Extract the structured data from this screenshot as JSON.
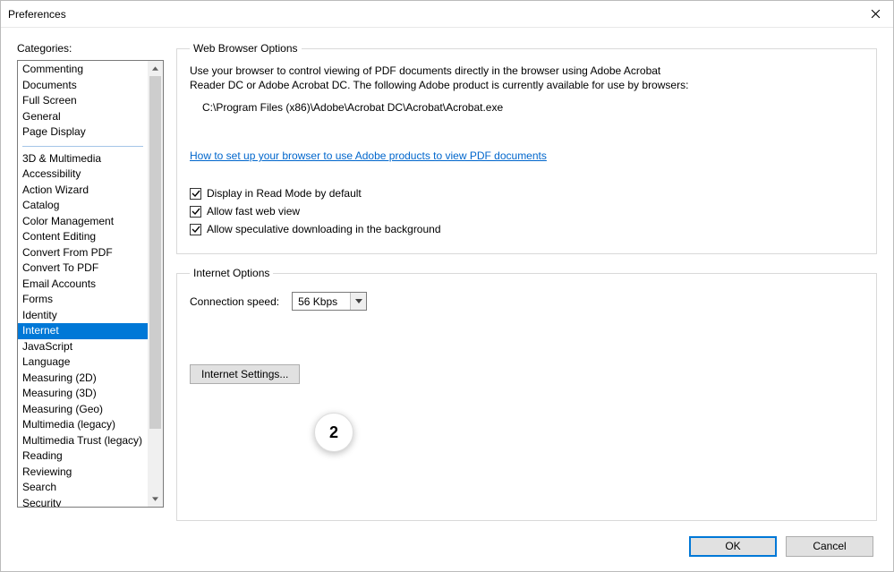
{
  "window": {
    "title": "Preferences"
  },
  "categories_label": "Categories:",
  "categories_group1": [
    "Commenting",
    "Documents",
    "Full Screen",
    "General",
    "Page Display"
  ],
  "categories_group2": [
    "3D & Multimedia",
    "Accessibility",
    "Action Wizard",
    "Catalog",
    "Color Management",
    "Content Editing",
    "Convert From PDF",
    "Convert To PDF",
    "Email Accounts",
    "Forms",
    "Identity",
    "Internet",
    "JavaScript",
    "Language",
    "Measuring (2D)",
    "Measuring (3D)",
    "Measuring (Geo)",
    "Multimedia (legacy)",
    "Multimedia Trust (legacy)",
    "Reading",
    "Reviewing",
    "Search",
    "Security"
  ],
  "selected_category": "Internet",
  "web_browser": {
    "legend": "Web Browser Options",
    "description": "Use your browser to control viewing of PDF documents directly in the browser using Adobe Acrobat Reader DC or Adobe Acrobat DC. The following Adobe product is currently available for use by browsers:",
    "path": "C:\\Program Files (x86)\\Adobe\\Acrobat DC\\Acrobat\\Acrobat.exe",
    "link": "How to set up your browser to use Adobe products to view PDF documents",
    "check_readmode": "Display in Read Mode by default",
    "check_fastweb": "Allow fast web view",
    "check_speculative": "Allow speculative downloading in the background"
  },
  "internet_options": {
    "legend": "Internet Options",
    "conn_label": "Connection speed:",
    "conn_value": "56 Kbps",
    "settings_button": "Internet Settings..."
  },
  "footer": {
    "ok": "OK",
    "cancel": "Cancel"
  },
  "annotation": "2"
}
